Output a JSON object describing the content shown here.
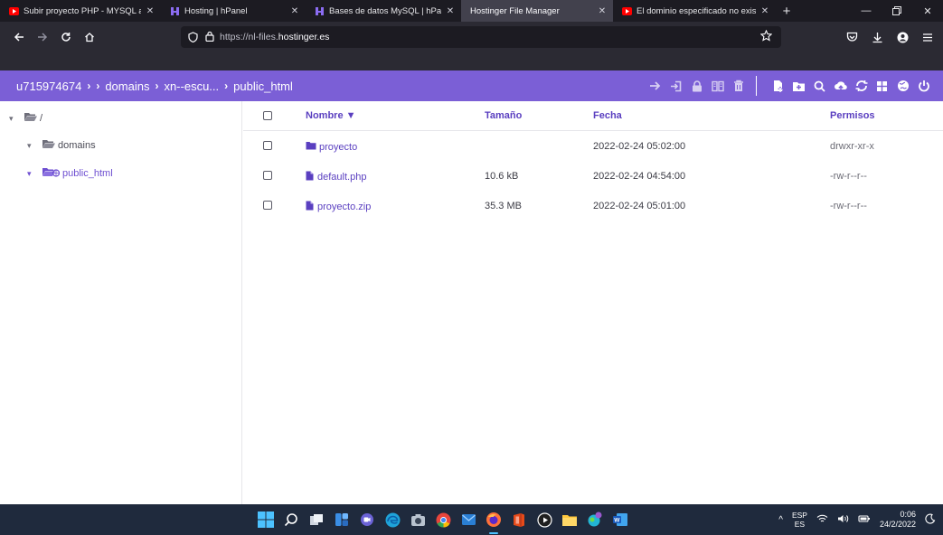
{
  "browser": {
    "tabs": [
      {
        "title": "Subir proyecto PHP - MYSQL a",
        "favicon": "youtube-icon",
        "active": false
      },
      {
        "title": "Hosting | hPanel",
        "favicon": "hostinger-icon",
        "active": false
      },
      {
        "title": "Bases de datos MySQL | hPanel",
        "favicon": "hostinger-icon",
        "active": false
      },
      {
        "title": "Hostinger File Manager",
        "favicon": "none",
        "active": true
      },
      {
        "title": "El dominio especificado no exis",
        "favicon": "youtube-icon",
        "active": false
      }
    ],
    "url_prefix": "https://nl-files.",
    "url_domain": "hostinger.es"
  },
  "breadcrumb": {
    "root": "u715974674",
    "items": [
      "domains",
      "xn--escu...",
      "public_html"
    ]
  },
  "sidebar": {
    "root_label": "/",
    "items": [
      {
        "label": "domains",
        "active": false
      },
      {
        "label": "public_html",
        "active": true
      }
    ]
  },
  "table": {
    "headers": {
      "name": "Nombre ▼",
      "size": "Tamaño",
      "date": "Fecha",
      "perms": "Permisos"
    },
    "rows": [
      {
        "name": "proyecto",
        "type": "folder",
        "size": "",
        "date": "2022-02-24 05:02:00",
        "perms": "drwxr-xr-x"
      },
      {
        "name": "default.php",
        "type": "file",
        "size": "10.6 kB",
        "date": "2022-02-24 04:54:00",
        "perms": "-rw-r--r--"
      },
      {
        "name": "proyecto.zip",
        "type": "file",
        "size": "35.3 MB",
        "date": "2022-02-24 05:01:00",
        "perms": "-rw-r--r--"
      }
    ]
  },
  "taskbar": {
    "lang_top": "ESP",
    "lang_bottom": "ES",
    "time": "0:06",
    "date": "24/2/2022"
  },
  "colors": {
    "accent": "#7b5fd6",
    "link": "#5a3fc0",
    "browser_dark": "#1c1b22"
  }
}
